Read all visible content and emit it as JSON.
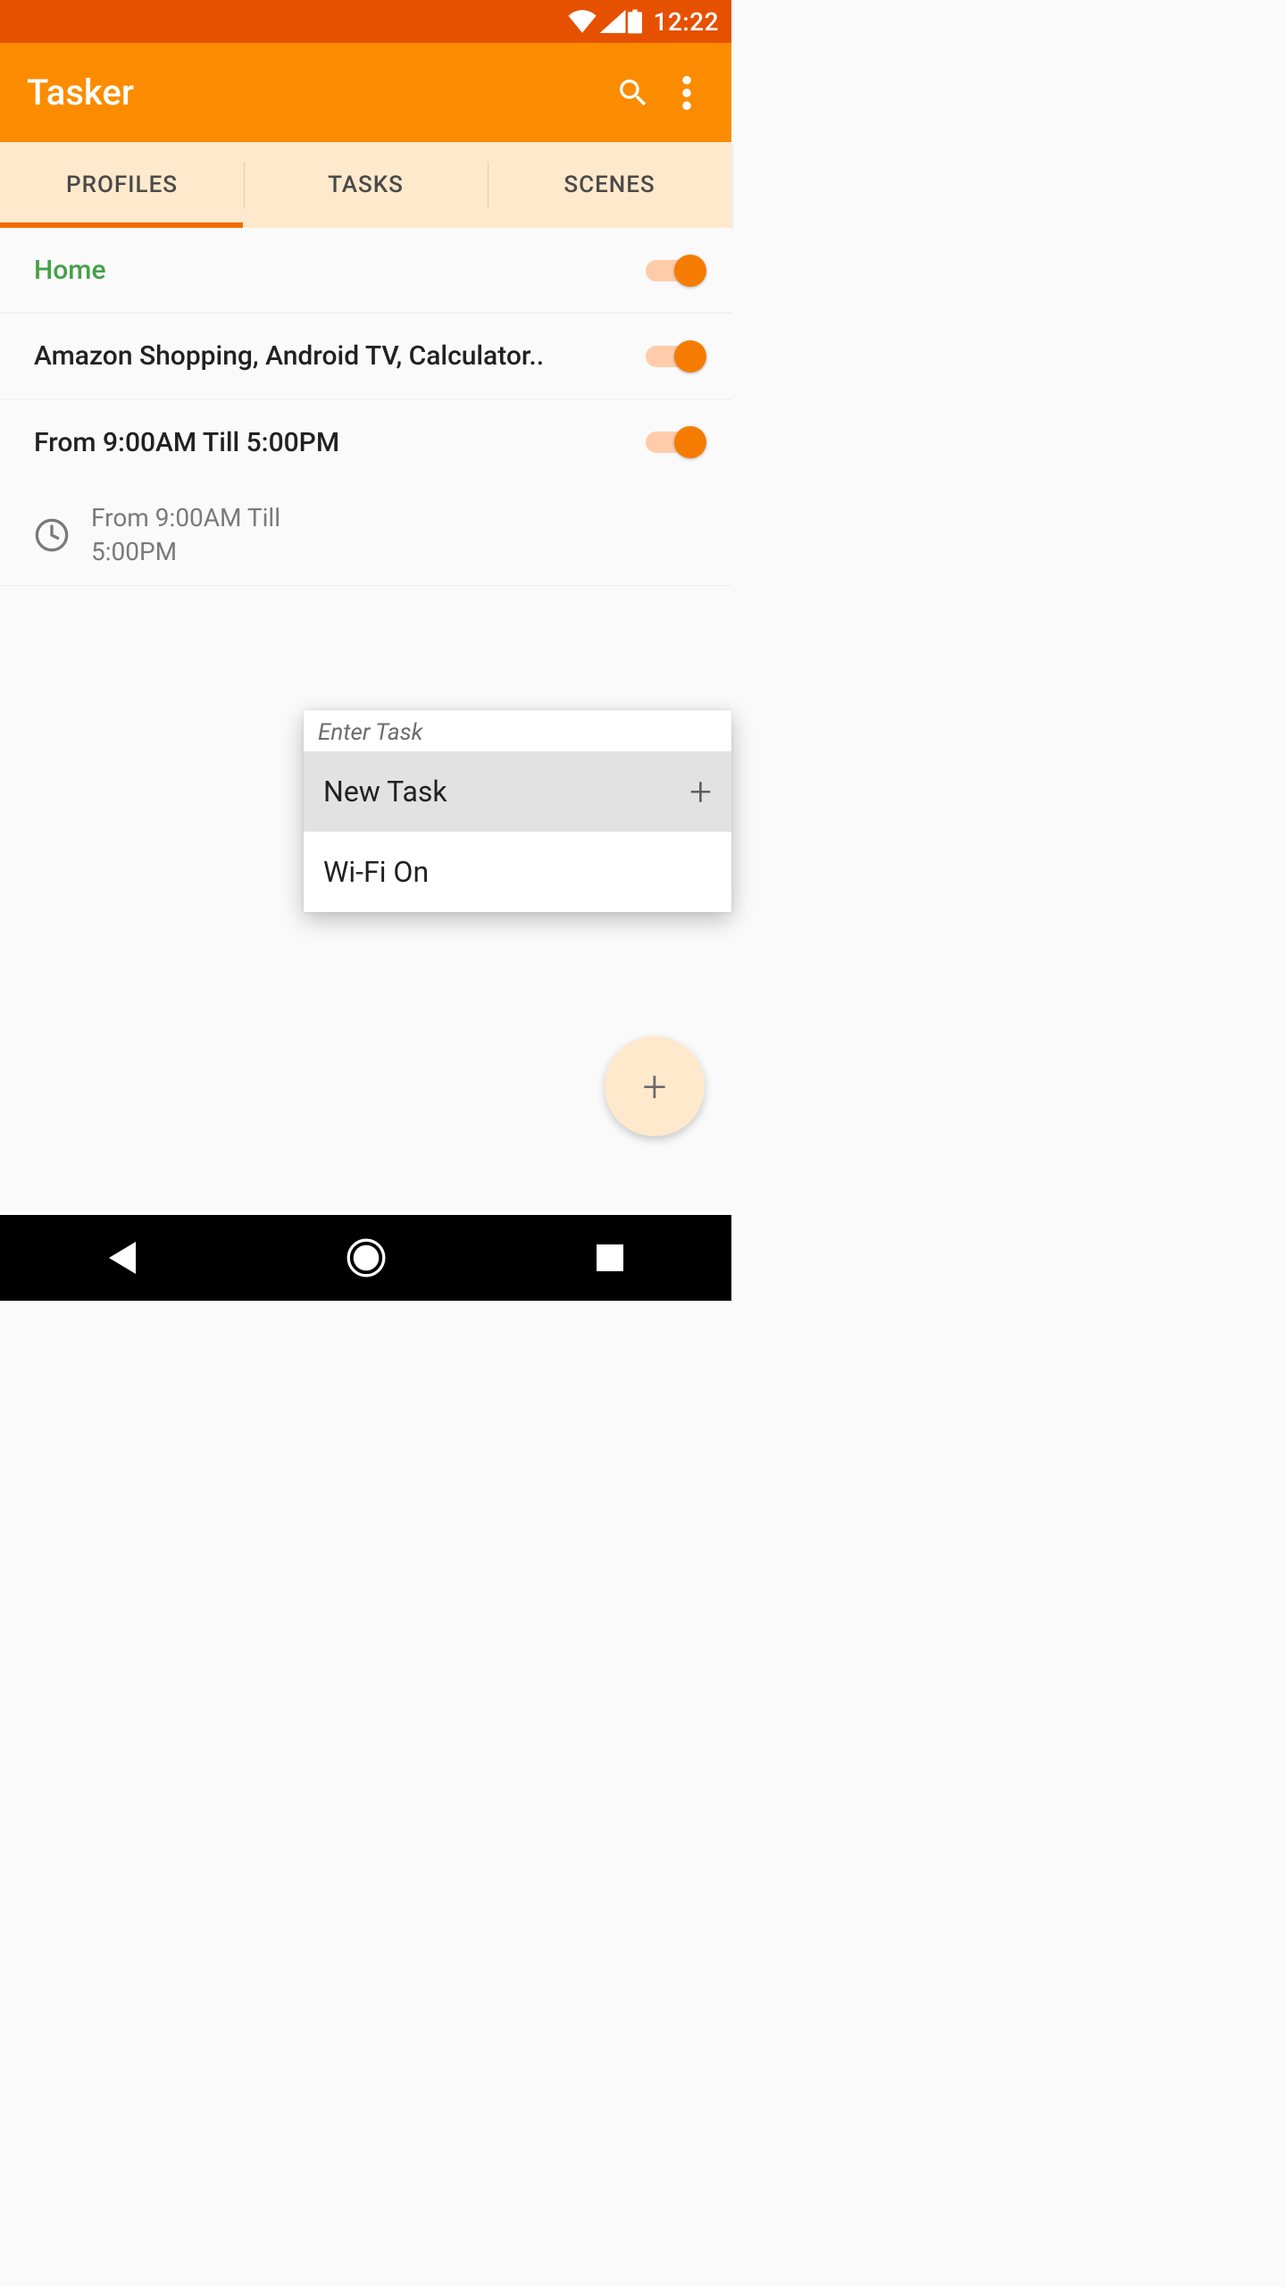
{
  "statusbar": {
    "time": "12:22"
  },
  "appbar": {
    "title": "Tasker"
  },
  "tabs": {
    "items": [
      "PROFILES",
      "TASKS",
      "SCENES"
    ],
    "active": 0
  },
  "profiles": [
    {
      "label": "Home",
      "enabled": true,
      "highlight": true
    },
    {
      "label": "Amazon Shopping, Android TV, Calculator..",
      "enabled": true
    },
    {
      "label": "From  9:00AM Till  5:00PM",
      "enabled": true,
      "detail": "From  9:00AM Till  5:00PM"
    }
  ],
  "popup": {
    "title": "Enter Task",
    "items": [
      {
        "label": "New Task",
        "has_add": true,
        "hover": true
      },
      {
        "label": "Wi-Fi On",
        "has_add": false,
        "hover": false
      }
    ]
  }
}
